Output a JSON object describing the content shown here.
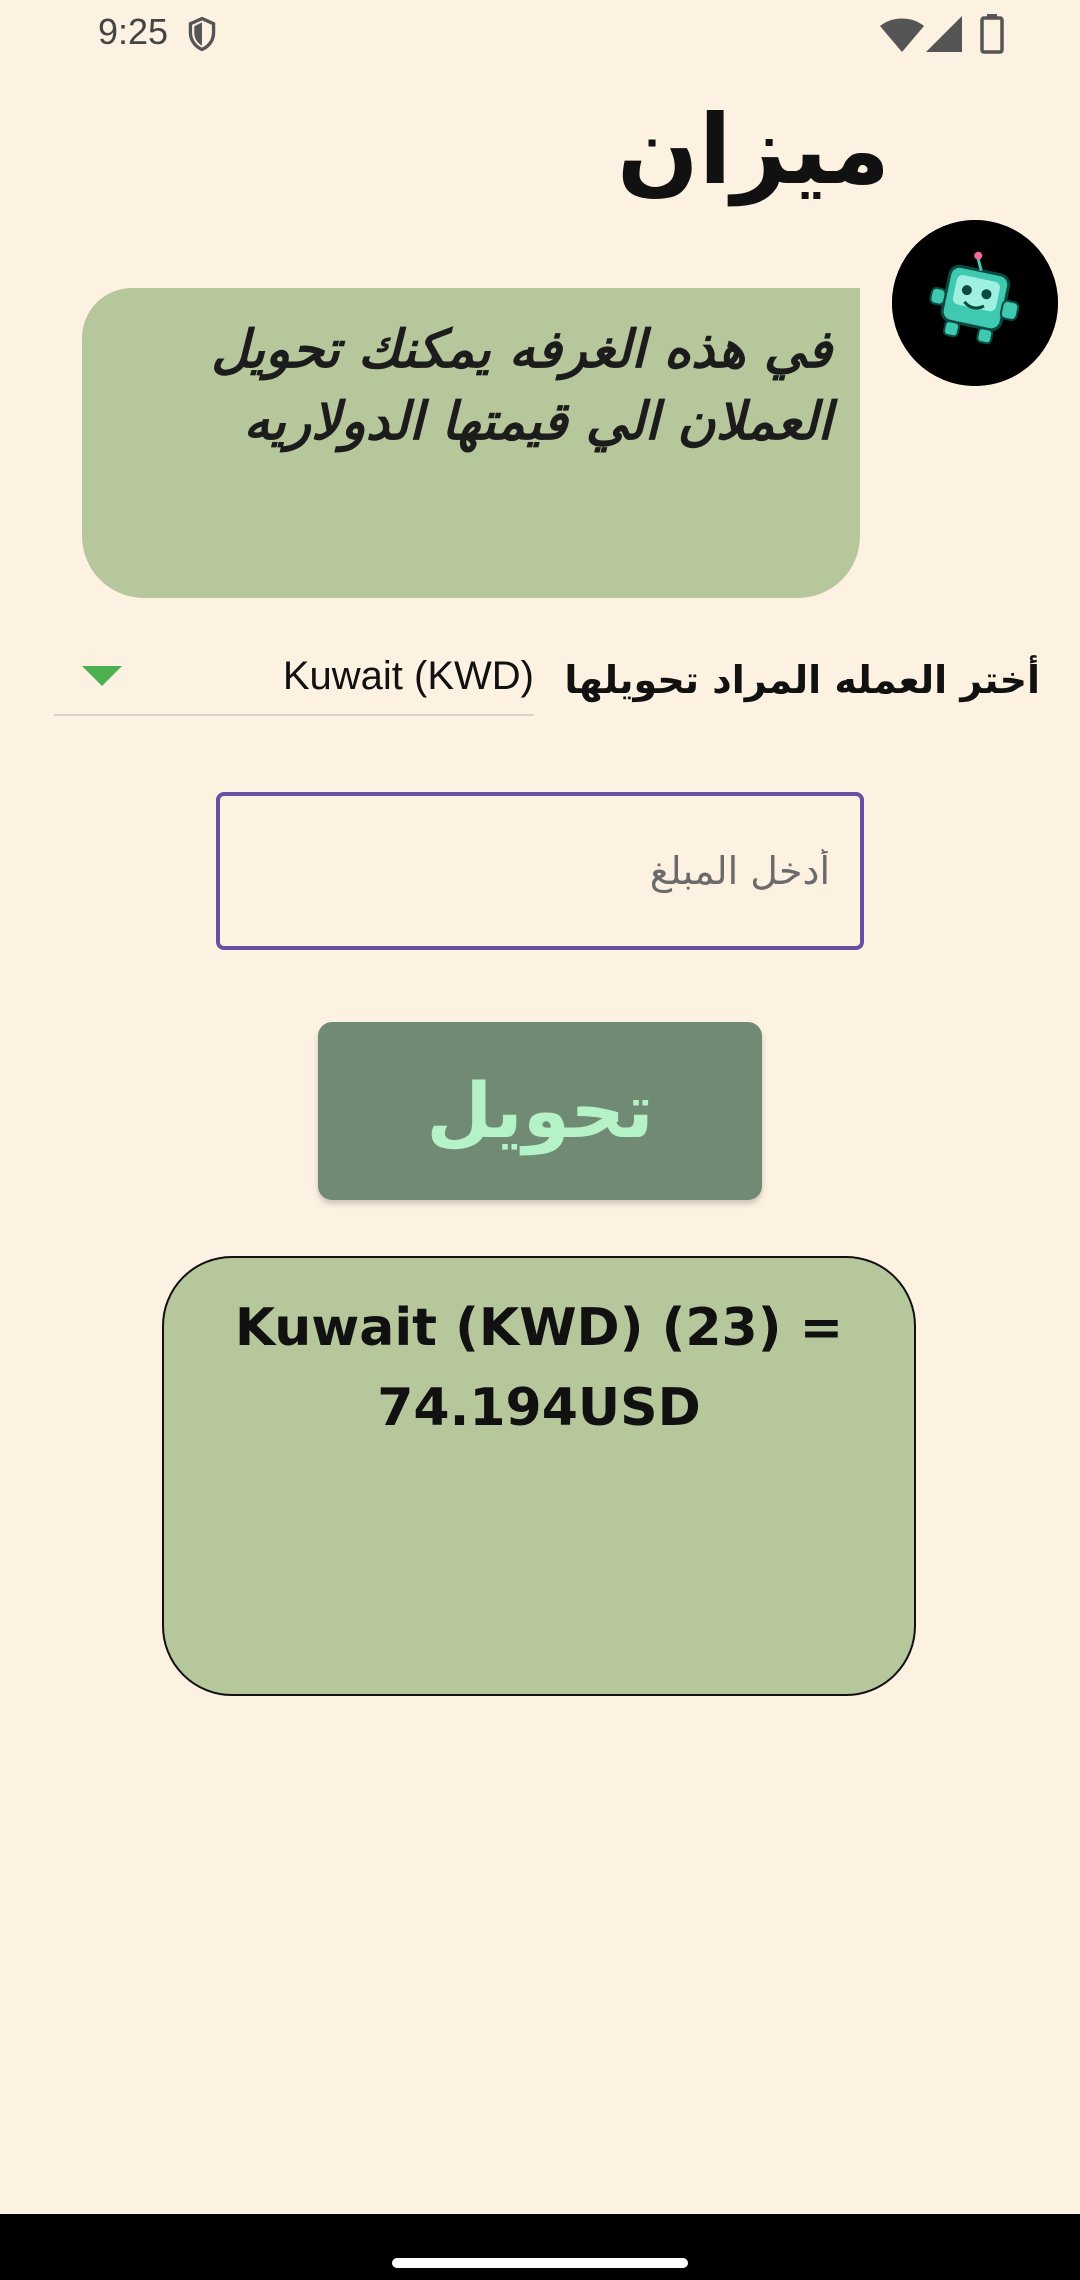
{
  "status_bar": {
    "time": "9:25",
    "icons": [
      "shield-icon",
      "wifi-icon",
      "signal-icon",
      "battery-icon"
    ]
  },
  "header": {
    "title": "ميزان"
  },
  "info_card": {
    "text": "في هذه الغرفه يمكنك تحويل العملان الي قيمتها الدولاريه"
  },
  "currency_select": {
    "label": "أختر العمله المراد تحويلها",
    "selected": "Kuwait (KWD)"
  },
  "amount_input": {
    "value": "",
    "placeholder": "أدخل المبلغ"
  },
  "convert_button": {
    "label": "تحويل"
  },
  "result": {
    "text": "Kuwait (KWD) (23) = 74.194USD"
  },
  "colors": {
    "background": "#fdf1e2",
    "card": "#b6c79b",
    "button": "#708a74",
    "button_text": "#b5f2c7",
    "input_border": "#6750a4",
    "dropdown_arrow": "#4caf50"
  }
}
